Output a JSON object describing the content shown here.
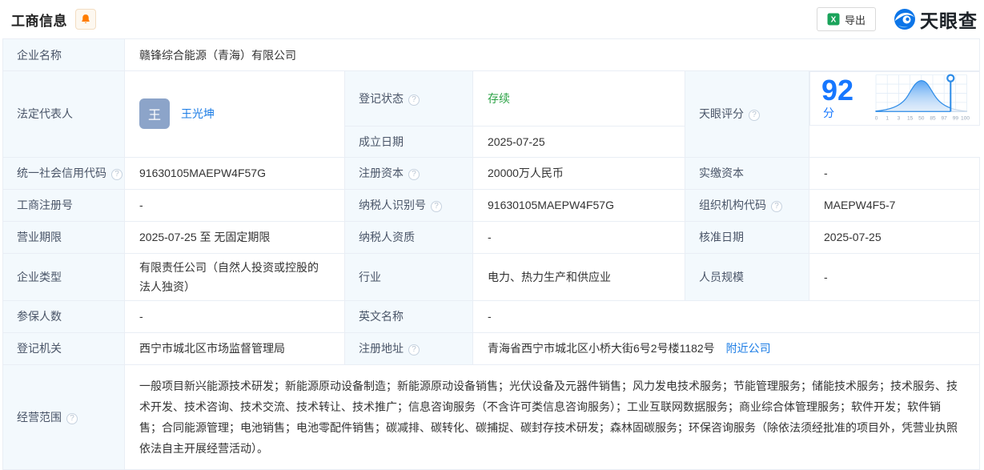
{
  "header": {
    "title": "工商信息",
    "export_label": "导出",
    "brand": "天眼查"
  },
  "score": {
    "label": "天眼评分",
    "value": "92",
    "unit": "分",
    "chart": {
      "type": "area",
      "description": "score distribution bell curve with marker pin at company score",
      "axis_labels": [
        "0",
        "1",
        "3",
        "15",
        "50",
        "85",
        "97",
        "99",
        "100"
      ],
      "marker_value": 92
    }
  },
  "fields": {
    "company_name": {
      "label": "企业名称",
      "value": "赣锋综合能源（青海）有限公司"
    },
    "legal_rep": {
      "label": "法定代表人",
      "avatar": "王",
      "value": "王光坤"
    },
    "reg_status": {
      "label": "登记状态",
      "value": "存续"
    },
    "establish_date": {
      "label": "成立日期",
      "value": "2025-07-25"
    },
    "credit_code": {
      "label": "统一社会信用代码",
      "value": "91630105MAEPW4F57G"
    },
    "reg_capital": {
      "label": "注册资本",
      "value": "20000万人民币"
    },
    "paid_capital": {
      "label": "实缴资本",
      "value": "-"
    },
    "reg_number": {
      "label": "工商注册号",
      "value": "-"
    },
    "taxpayer_id": {
      "label": "纳税人识别号",
      "value": "91630105MAEPW4F57G"
    },
    "org_code": {
      "label": "组织机构代码",
      "value": "MAEPW4F5-7"
    },
    "business_term": {
      "label": "营业期限",
      "value": "2025-07-25 至 无固定期限"
    },
    "taxpayer_quality": {
      "label": "纳税人资质",
      "value": "-"
    },
    "approval_date": {
      "label": "核准日期",
      "value": "2025-07-25"
    },
    "company_type": {
      "label": "企业类型",
      "value": "有限责任公司（自然人投资或控股的法人独资）"
    },
    "industry": {
      "label": "行业",
      "value": "电力、热力生产和供应业"
    },
    "staff_size": {
      "label": "人员规模",
      "value": "-"
    },
    "insured_count": {
      "label": "参保人数",
      "value": "-"
    },
    "english_name": {
      "label": "英文名称",
      "value": "-"
    },
    "reg_authority": {
      "label": "登记机关",
      "value": "西宁市城北区市场监督管理局"
    },
    "reg_address": {
      "label": "注册地址",
      "value": "青海省西宁市城北区小桥大街6号2号楼1182号",
      "nearby_link": "附近公司"
    },
    "business_scope": {
      "label": "经营范围",
      "value": "一般项目新兴能源技术研发；新能源原动设备制造；新能源原动设备销售；光伏设备及元器件销售；风力发电技术服务；节能管理服务；储能技术服务；技术服务、技术开发、技术咨询、技术交流、技术转让、技术推广；信息咨询服务（不含许可类信息咨询服务）；工业互联网数据服务；商业综合体管理服务；软件开发；软件销售；合同能源管理；电池销售；电池零配件销售；碳减排、碳转化、碳捕捉、碳封存技术研发；森林固碳服务；环保咨询服务（除依法须经批准的项目外，凭营业执照依法自主开展经营活动）。"
    }
  },
  "colors": {
    "accent_blue": "#1677ff",
    "link_blue": "#1b7ce5",
    "status_green": "#2ba245",
    "brand_orange": "#ff7d00",
    "excel_green": "#1aa35a"
  }
}
